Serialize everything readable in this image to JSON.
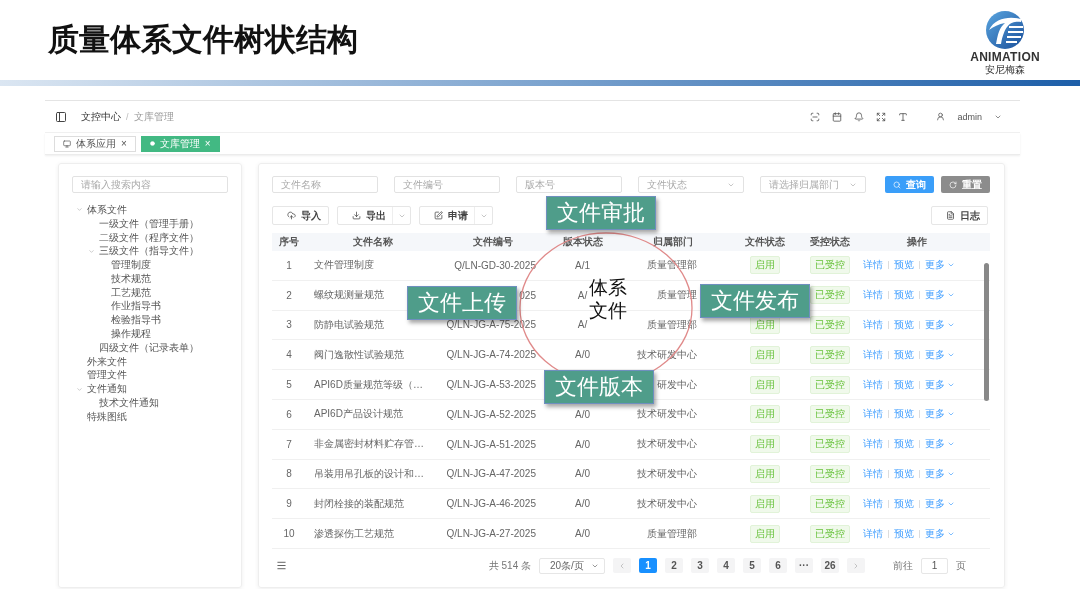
{
  "slide": {
    "title": "质量体系文件树状结构",
    "logo": {
      "name": "ANIMATION",
      "subtitle": "安尼梅森"
    }
  },
  "app": {
    "breadcrumb": [
      "文控中心",
      "文库管理"
    ],
    "breadcrumb_separator": "/",
    "user": "admin",
    "tabs": [
      {
        "label": "体系应用",
        "close": "×",
        "selected": false
      },
      {
        "label": "文库管理",
        "close": "×",
        "selected": true
      }
    ],
    "tree": {
      "placeholder": "请输入搜索内容",
      "items": [
        {
          "label": "体系文件",
          "expanded": true,
          "children": [
            {
              "label": "一级文件（管理手册）"
            },
            {
              "label": "二级文件（程序文件）"
            },
            {
              "label": "三级文件（指导文件）",
              "expanded": true,
              "children": [
                {
                  "label": "管理制度"
                },
                {
                  "label": "技术规范"
                },
                {
                  "label": "工艺规范"
                },
                {
                  "label": "作业指导书"
                },
                {
                  "label": "检验指导书"
                },
                {
                  "label": "操作规程"
                }
              ]
            },
            {
              "label": "四级文件（记录表单）"
            }
          ]
        },
        {
          "label": "外来文件"
        },
        {
          "label": "管理文件"
        },
        {
          "label": "文件通知",
          "expanded": true,
          "children": [
            {
              "label": "技术文件通知"
            }
          ]
        },
        {
          "label": "特殊图纸"
        }
      ]
    },
    "filters": [
      {
        "kind": "input",
        "placeholder": "文件名称"
      },
      {
        "kind": "input",
        "placeholder": "文件编号"
      },
      {
        "kind": "input",
        "placeholder": "版本号"
      },
      {
        "kind": "select",
        "placeholder": "文件状态"
      },
      {
        "kind": "select",
        "placeholder": "请选择归属部门"
      }
    ],
    "buttons": [
      {
        "kind": "primary",
        "label": "查询"
      },
      {
        "kind": "secondary",
        "label": "重置"
      }
    ],
    "toolbar": [
      {
        "kind": "import",
        "label": "导入"
      },
      {
        "kind": "export",
        "label": "导出"
      },
      {
        "kind": "apply",
        "label": "申请"
      }
    ],
    "log_button": "日志",
    "table": {
      "columns": [
        "序号",
        "文件名称",
        "文件编号",
        "版本状态",
        "归属部门",
        "文件状态",
        "受控状态",
        "操作"
      ],
      "rows": [
        {
          "index": "1",
          "name": "文件管理制度",
          "code": "Q/LN-GD-30-2025",
          "version": "A/1",
          "dept": "质量管理部",
          "status": "启用",
          "control": "已受控",
          "actions": [
            "详情",
            "预览",
            "更多"
          ]
        },
        {
          "index": "2",
          "name": "螺纹规测量规范",
          "code": "025",
          "version": "A/",
          "dept": "质量管理",
          "control": "已受控",
          "actions": [
            "详情",
            "预览",
            "更多"
          ]
        },
        {
          "index": "3",
          "name": "防静电试验规范",
          "code": "Q/LN-JG-A-75-2025",
          "version": "A/",
          "dept": "质量管理部",
          "status": "启用",
          "control": "已受控",
          "actions": [
            "详情",
            "预览",
            "更多"
          ]
        },
        {
          "index": "4",
          "name": "阀门逸散性试验规范",
          "code": "Q/LN-JG-A-74-2025",
          "version": "A/0",
          "dept": "技术研发中心",
          "status": "启用",
          "control": "已受控",
          "actions": [
            "详情",
            "预览",
            "更多"
          ]
        },
        {
          "index": "5",
          "name": "API6D质量规范等级（…",
          "code": "Q/LN-JG-A-53-2025",
          "dept": "研发中心",
          "status": "启用",
          "control": "已受控",
          "actions": [
            "详情",
            "预览",
            "更多"
          ]
        },
        {
          "index": "6",
          "name": "API6D产品设计规范",
          "code": "Q/LN-JG-A-52-2025",
          "version": "A/0",
          "dept": "技术研发中心",
          "status": "启用",
          "control": "已受控",
          "actions": [
            "详情",
            "预览",
            "更多"
          ]
        },
        {
          "index": "7",
          "name": "非金属密封材料贮存管…",
          "code": "Q/LN-JG-A-51-2025",
          "version": "A/0",
          "dept": "技术研发中心",
          "status": "启用",
          "control": "已受控",
          "actions": [
            "详情",
            "预览",
            "更多"
          ]
        },
        {
          "index": "8",
          "name": "吊装用吊孔板的设计和…",
          "code": "Q/LN-JG-A-47-2025",
          "version": "A/0",
          "dept": "技术研发中心",
          "status": "启用",
          "control": "已受控",
          "actions": [
            "详情",
            "预览",
            "更多"
          ]
        },
        {
          "index": "9",
          "name": "封闭栓接的装配规范",
          "code": "Q/LN-JG-A-46-2025",
          "version": "A/0",
          "dept": "技术研发中心",
          "status": "启用",
          "control": "已受控",
          "actions": [
            "详情",
            "预览",
            "更多"
          ]
        },
        {
          "index": "10",
          "name": "渗透探伤工艺规范",
          "code": "Q/LN-JG-A-27-2025",
          "version": "A/0",
          "dept": "质量管理部",
          "status": "启用",
          "control": "已受控",
          "actions": [
            "详情",
            "预览",
            "更多"
          ]
        }
      ]
    },
    "pagination": {
      "total": "共 514 条",
      "page_size": "20条/页",
      "pages": [
        {
          "label": "1",
          "selected": true
        },
        {
          "label": "2",
          "selected": false
        },
        {
          "label": "3",
          "selected": false
        },
        {
          "label": "4",
          "selected": false
        },
        {
          "label": "5",
          "selected": false
        },
        {
          "label": "6",
          "selected": false
        },
        {
          "label": "···",
          "selected": false
        },
        {
          "label": "26",
          "selected": false
        }
      ],
      "goto_label": "前往",
      "goto_value": "1",
      "goto_suffix": "页"
    }
  },
  "diagram": {
    "center": [
      "体系",
      "文件"
    ],
    "callouts": [
      {
        "label": "文件审批"
      },
      {
        "label": "文件上传"
      },
      {
        "label": "文件发布"
      },
      {
        "label": "文件版本"
      }
    ]
  }
}
